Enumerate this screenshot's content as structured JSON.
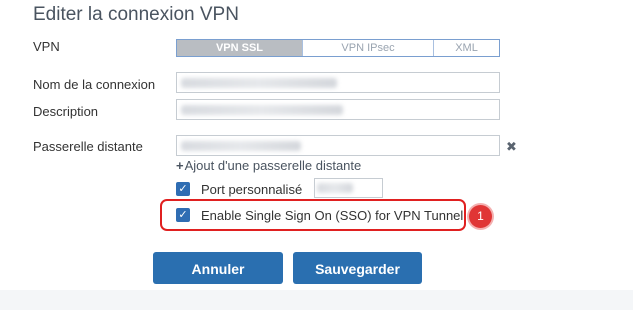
{
  "dialog": {
    "title": "Editer la connexion VPN"
  },
  "form": {
    "vpn_label": "VPN",
    "vpn_types": [
      "VPN SSL",
      "VPN IPsec",
      "XML"
    ],
    "vpn_selected": "VPN SSL",
    "connection_name_label": "Nom de la connexion",
    "description_label": "Description",
    "remote_gateway_label": "Passerelle distante",
    "add_gateway_link": "Ajout d'une passerelle distante",
    "custom_port_label": "Port personnalisé",
    "custom_port_checked": true,
    "sso_label": "Enable Single Sign On (SSO) for VPN Tunnel",
    "sso_checked": true
  },
  "annotation": {
    "badge_number": "1",
    "highlight_color": "#e02020"
  },
  "actions": {
    "cancel_label": "Annuler",
    "save_label": "Sauvegarder"
  },
  "colors": {
    "primary_button": "#2a6fb0",
    "checkbox": "#2f6db3",
    "segment_active": "#b9bdc2"
  },
  "icons": {
    "clear_gateway": "close-icon",
    "add_gateway": "plus-icon",
    "checkmark": "check-icon"
  }
}
